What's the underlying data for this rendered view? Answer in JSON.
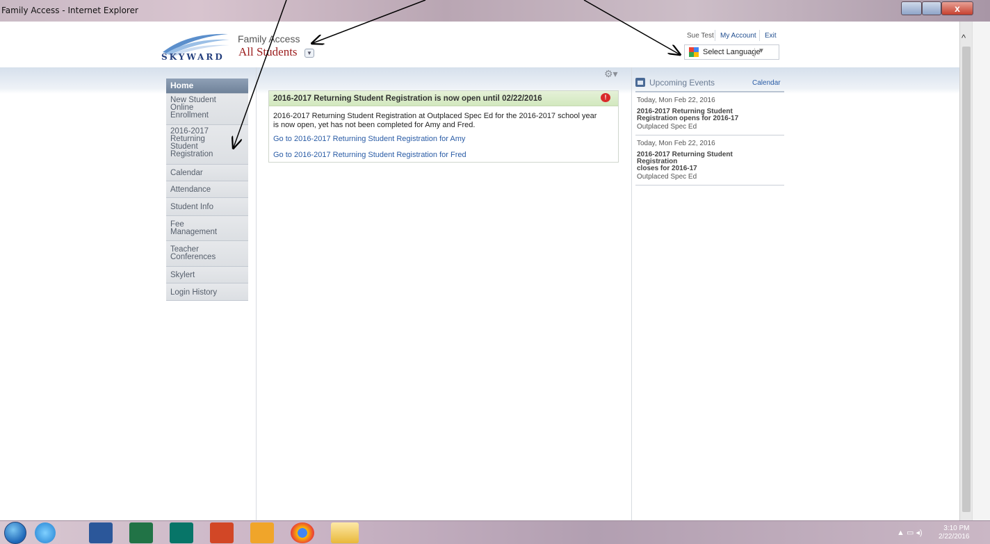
{
  "window": {
    "title": "Family Access - Internet Explorer",
    "close_glyph": "x"
  },
  "header": {
    "logo_text": "SKYWARD",
    "app_name": "Family Access",
    "student_select": "All Students",
    "user_name": "Sue Test",
    "my_account": "My Account",
    "exit": "Exit",
    "language_label": "Select Language"
  },
  "sidebar": {
    "items": [
      {
        "label": "Home",
        "active": true
      },
      {
        "label": "New Student\nOnline\nEnrollment",
        "active": false
      },
      {
        "label": "2016-2017\nReturning\nStudent\nRegistration",
        "active": false
      },
      {
        "label": "Calendar",
        "active": false
      },
      {
        "label": "Attendance",
        "active": false
      },
      {
        "label": "Student Info",
        "active": false
      },
      {
        "label": "Fee\nManagement",
        "active": false
      },
      {
        "label": "Teacher\nConferences",
        "active": false
      },
      {
        "label": "Skylert",
        "active": false
      },
      {
        "label": "Login History",
        "active": false
      }
    ]
  },
  "alert": {
    "title": "2016-2017 Returning Student Registration is now open until 02/22/2016",
    "badge": "!",
    "body": "2016-2017 Returning Student Registration at Outplaced Spec Ed for the 2016-2017 school year is now open, yet has not been completed for Amy and Fred.",
    "link_amy": "Go to 2016-2017 Returning Student Registration for Amy",
    "link_fred": "Go to 2016-2017 Returning Student Registration for Fred"
  },
  "events": {
    "title": "Upcoming Events",
    "calendar_link": "Calendar",
    "items": [
      {
        "date": "Today, Mon Feb 22, 2016",
        "title": "2016-2017 Returning Student\nRegistration opens for 2016-17",
        "location": "Outplaced Spec Ed"
      },
      {
        "date": "Today, Mon Feb 22, 2016",
        "title": "2016-2017 Returning Student\nRegistration\n    closes for 2016-17",
        "location": "Outplaced Spec Ed"
      }
    ]
  },
  "taskbar": {
    "time": "3:10 PM",
    "date": "2/22/2016",
    "apps": [
      "windows-start",
      "internet-explorer",
      "word",
      "excel",
      "publisher",
      "powerpoint",
      "outlook",
      "chrome",
      "file-explorer"
    ]
  },
  "colors": {
    "nav_active": "#7f91a8",
    "alert_header": "#d8ebc6",
    "link": "#2a5ca6",
    "student_select": "#9b1b1b"
  }
}
